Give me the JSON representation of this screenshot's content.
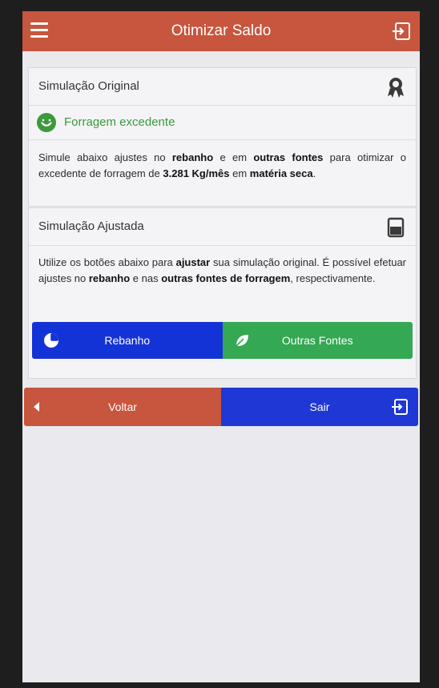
{
  "app": {
    "title": "Otimizar Saldo",
    "colors": {
      "appbar": "#c8553d",
      "primary_blue": "#1433d6",
      "success_green": "#34a853",
      "status_text_green": "#3b9a3d"
    }
  },
  "original": {
    "title": "Simulação Original",
    "badge_icon": "award-ribbon-icon",
    "status_icon": "smile-icon",
    "status_text": "Forragem excedente",
    "desc": {
      "p1": "Simule abaixo ajustes no ",
      "b1": "rebanho",
      "p2": " e em ",
      "b2": "outras fontes",
      "p3": " para otimizar o excedente de forragem de ",
      "b3": "3.281 Kg/mês",
      "p4": " em ",
      "b4": "matéria seca",
      "p5": "."
    }
  },
  "adjusted": {
    "title": "Simulação Ajustada",
    "badge_icon": "beaker-icon",
    "desc": {
      "p1": "Utilize os botões abaixo para ",
      "b1": "ajustar",
      "p2": " sua simulação original. É possível efetuar ajustes no ",
      "b2": "rebanho",
      "p3": " e  nas ",
      "b3": "outras fontes de forragem",
      "p4": ", respectivamente."
    },
    "btn_herd": {
      "label": "Rebanho",
      "icon": "pie-chart-icon"
    },
    "btn_other": {
      "label": "Outras Fontes",
      "icon": "leaf-icon"
    }
  },
  "nav": {
    "back_label": "Voltar",
    "exit_label": "Sair",
    "back_icon": "chevron-left-icon",
    "exit_icon": "sign-out-icon"
  }
}
